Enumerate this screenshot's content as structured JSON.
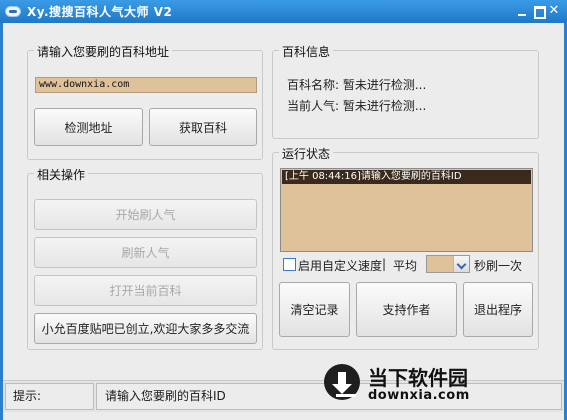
{
  "window": {
    "title": "Xy.搜搜百科人气大师 V2"
  },
  "url_group": {
    "title": "请输入您要刷的百科地址",
    "url_value": "www.downxia.com",
    "detect_label": "检测地址",
    "fetch_label": "获取百科"
  },
  "info_group": {
    "title": "百科信息",
    "name_text": "百科名称: 暂未进行检测...",
    "popularity_text": "当前人气: 暂未进行检测..."
  },
  "ops_group": {
    "title": "相关操作",
    "start_label": "开始刷人气",
    "refresh_label": "刷新人气",
    "open_label": "打开当前百科",
    "notice_label": "小允百度贴吧已创立,欢迎大家多多交流"
  },
  "run_group": {
    "title": "运行状态",
    "log_line": "[上午 08:44:16]请输入您要刷的百科ID",
    "custom_speed_label": "启用自定义速度",
    "separator": "|",
    "avg_label": "平均",
    "per_sec_label": "秒刷一次",
    "clear_label": "清空记录",
    "support_label": "支持作者",
    "exit_label": "退出程序"
  },
  "status_bar": {
    "hint_label": "提示:",
    "hint_text": "请输入您要刷的百科ID"
  },
  "watermark": {
    "name": "当下软件园",
    "domain": "downxia.com"
  }
}
